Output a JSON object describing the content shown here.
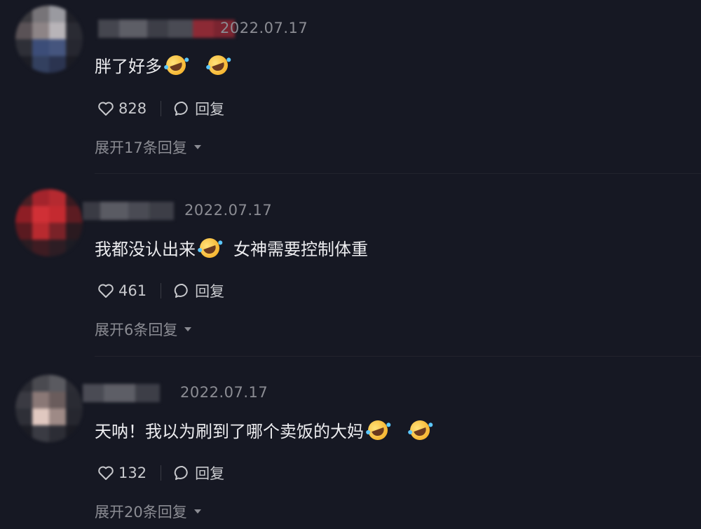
{
  "comments": [
    {
      "date": "2022.07.17",
      "text_parts": [
        "胖了好多"
      ],
      "emoji": "laughing-tears-icon",
      "likes": "828",
      "reply_label": "回复",
      "expand_label": "展开17条回复"
    },
    {
      "date": "2022.07.17",
      "text_parts": [
        "我都没认出来",
        "女神需要控制体重"
      ],
      "emoji": "laughing-tears-icon",
      "likes": "461",
      "reply_label": "回复",
      "expand_label": "展开6条回复"
    },
    {
      "date": "2022.07.17",
      "text_parts": [
        "天呐！我以为刷到了哪个卖饭的大妈"
      ],
      "emoji": "laughing-tears-icon",
      "likes": "132",
      "reply_label": "回复",
      "expand_label": "展开20条回复"
    }
  ],
  "colors": {
    "background": "#161823",
    "primary_text": "#ececef",
    "secondary_text": "#8b8c93"
  }
}
